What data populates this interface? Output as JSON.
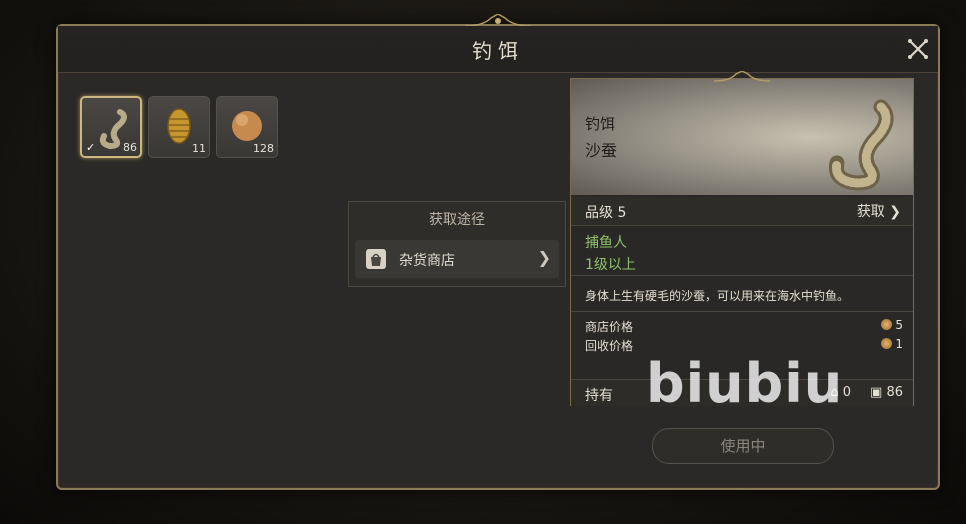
{
  "window": {
    "title": "钓饵"
  },
  "inventory": {
    "slots": [
      {
        "icon": "sand-worm-icon",
        "count": "86",
        "selected": true
      },
      {
        "icon": "cocoon-bait-icon",
        "count": "11",
        "selected": false
      },
      {
        "icon": "dough-ball-icon",
        "count": "128",
        "selected": false
      }
    ]
  },
  "acquisition": {
    "title": "获取途径",
    "sources": [
      {
        "icon": "shop-bag-icon",
        "label": "杂货商店"
      }
    ]
  },
  "detail": {
    "type": "钓饵",
    "name": "沙蚕",
    "grade": "品级 5",
    "get_label": "获取",
    "requirement_job": "捕鱼人",
    "requirement_level": "1级以上",
    "description": "身体上生有硬毛的沙蚕，可以用来在海水中钓鱼。",
    "shop_price_label": "商店价格",
    "shop_price": "5",
    "sell_price_label": "回收价格",
    "sell_price": "1",
    "own_label": "持有",
    "own_equipped": "0",
    "own_bag": "86"
  },
  "use_button": "使用中",
  "watermark": "biubiu",
  "colors": {
    "accent_gold": "#cdb680",
    "requirement_green": "#8ec26a"
  }
}
